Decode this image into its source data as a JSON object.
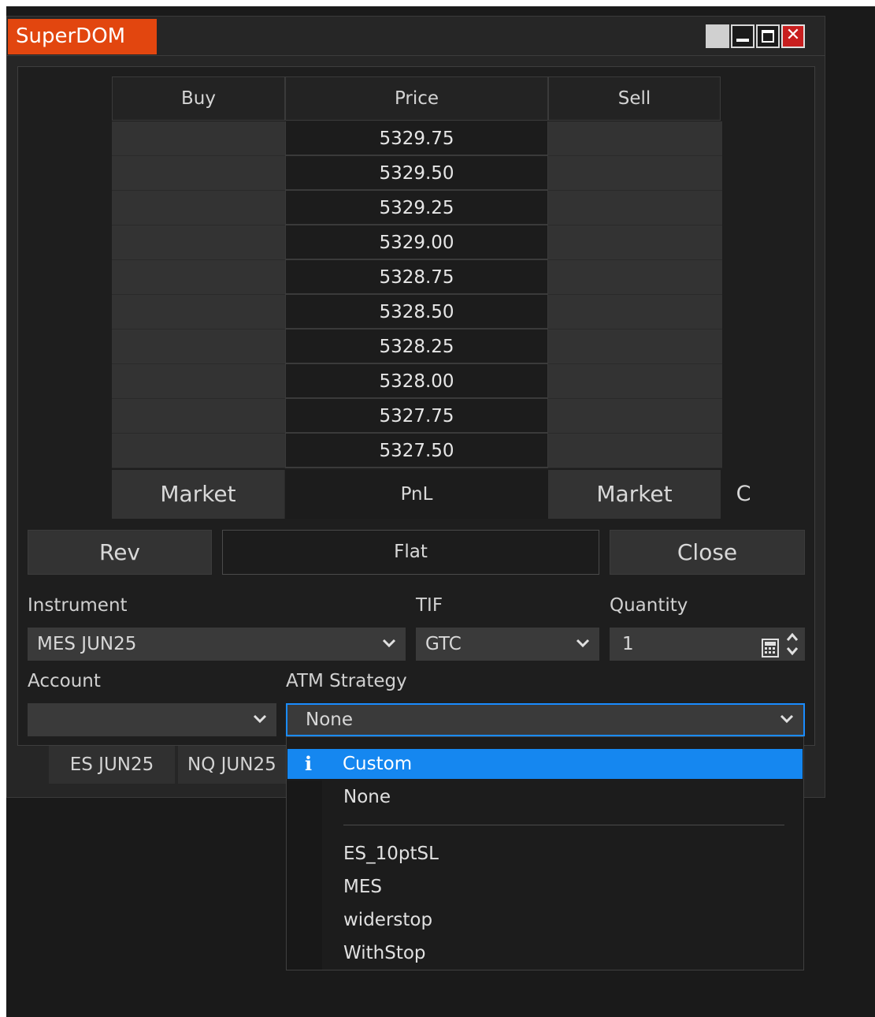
{
  "window": {
    "title": "SuperDOM",
    "close_glyph": "✕"
  },
  "ladder": {
    "headers": {
      "buy": "Buy",
      "price": "Price",
      "sell": "Sell"
    },
    "prices": [
      "5329.75",
      "5329.50",
      "5329.25",
      "5329.00",
      "5328.75",
      "5328.50",
      "5328.25",
      "5328.00",
      "5327.75",
      "5327.50"
    ],
    "footer": {
      "buy_market": "Market",
      "pnl": "PnL",
      "sell_market": "Market",
      "side_label": "C"
    }
  },
  "actions": {
    "rev": "Rev",
    "flat": "Flat",
    "close": "Close"
  },
  "form": {
    "instrument_label": "Instrument",
    "instrument_value": "MES JUN25",
    "tif_label": "TIF",
    "tif_value": "GTC",
    "quantity_label": "Quantity",
    "quantity_value": "1",
    "account_label": "Account",
    "account_value": "",
    "atm_label": "ATM Strategy",
    "atm_value": "None"
  },
  "instrument_tabs": [
    "ES JUN25",
    "NQ JUN25"
  ],
  "atm_dropdown": {
    "info_glyph": "i",
    "selected": "Custom",
    "items": [
      "None",
      "ES_10ptSL",
      "MES",
      "widerstop",
      "WithStop"
    ]
  },
  "icons": {
    "chevron": "chevron-down-icon",
    "calculator": "calculator-icon",
    "spinner": "spinner-icon",
    "info": "info-icon"
  },
  "colors": {
    "title_accent": "#e2460f",
    "highlight": "#1587f0",
    "close_button": "#c81f1f",
    "focus_border": "#1a8cff"
  }
}
